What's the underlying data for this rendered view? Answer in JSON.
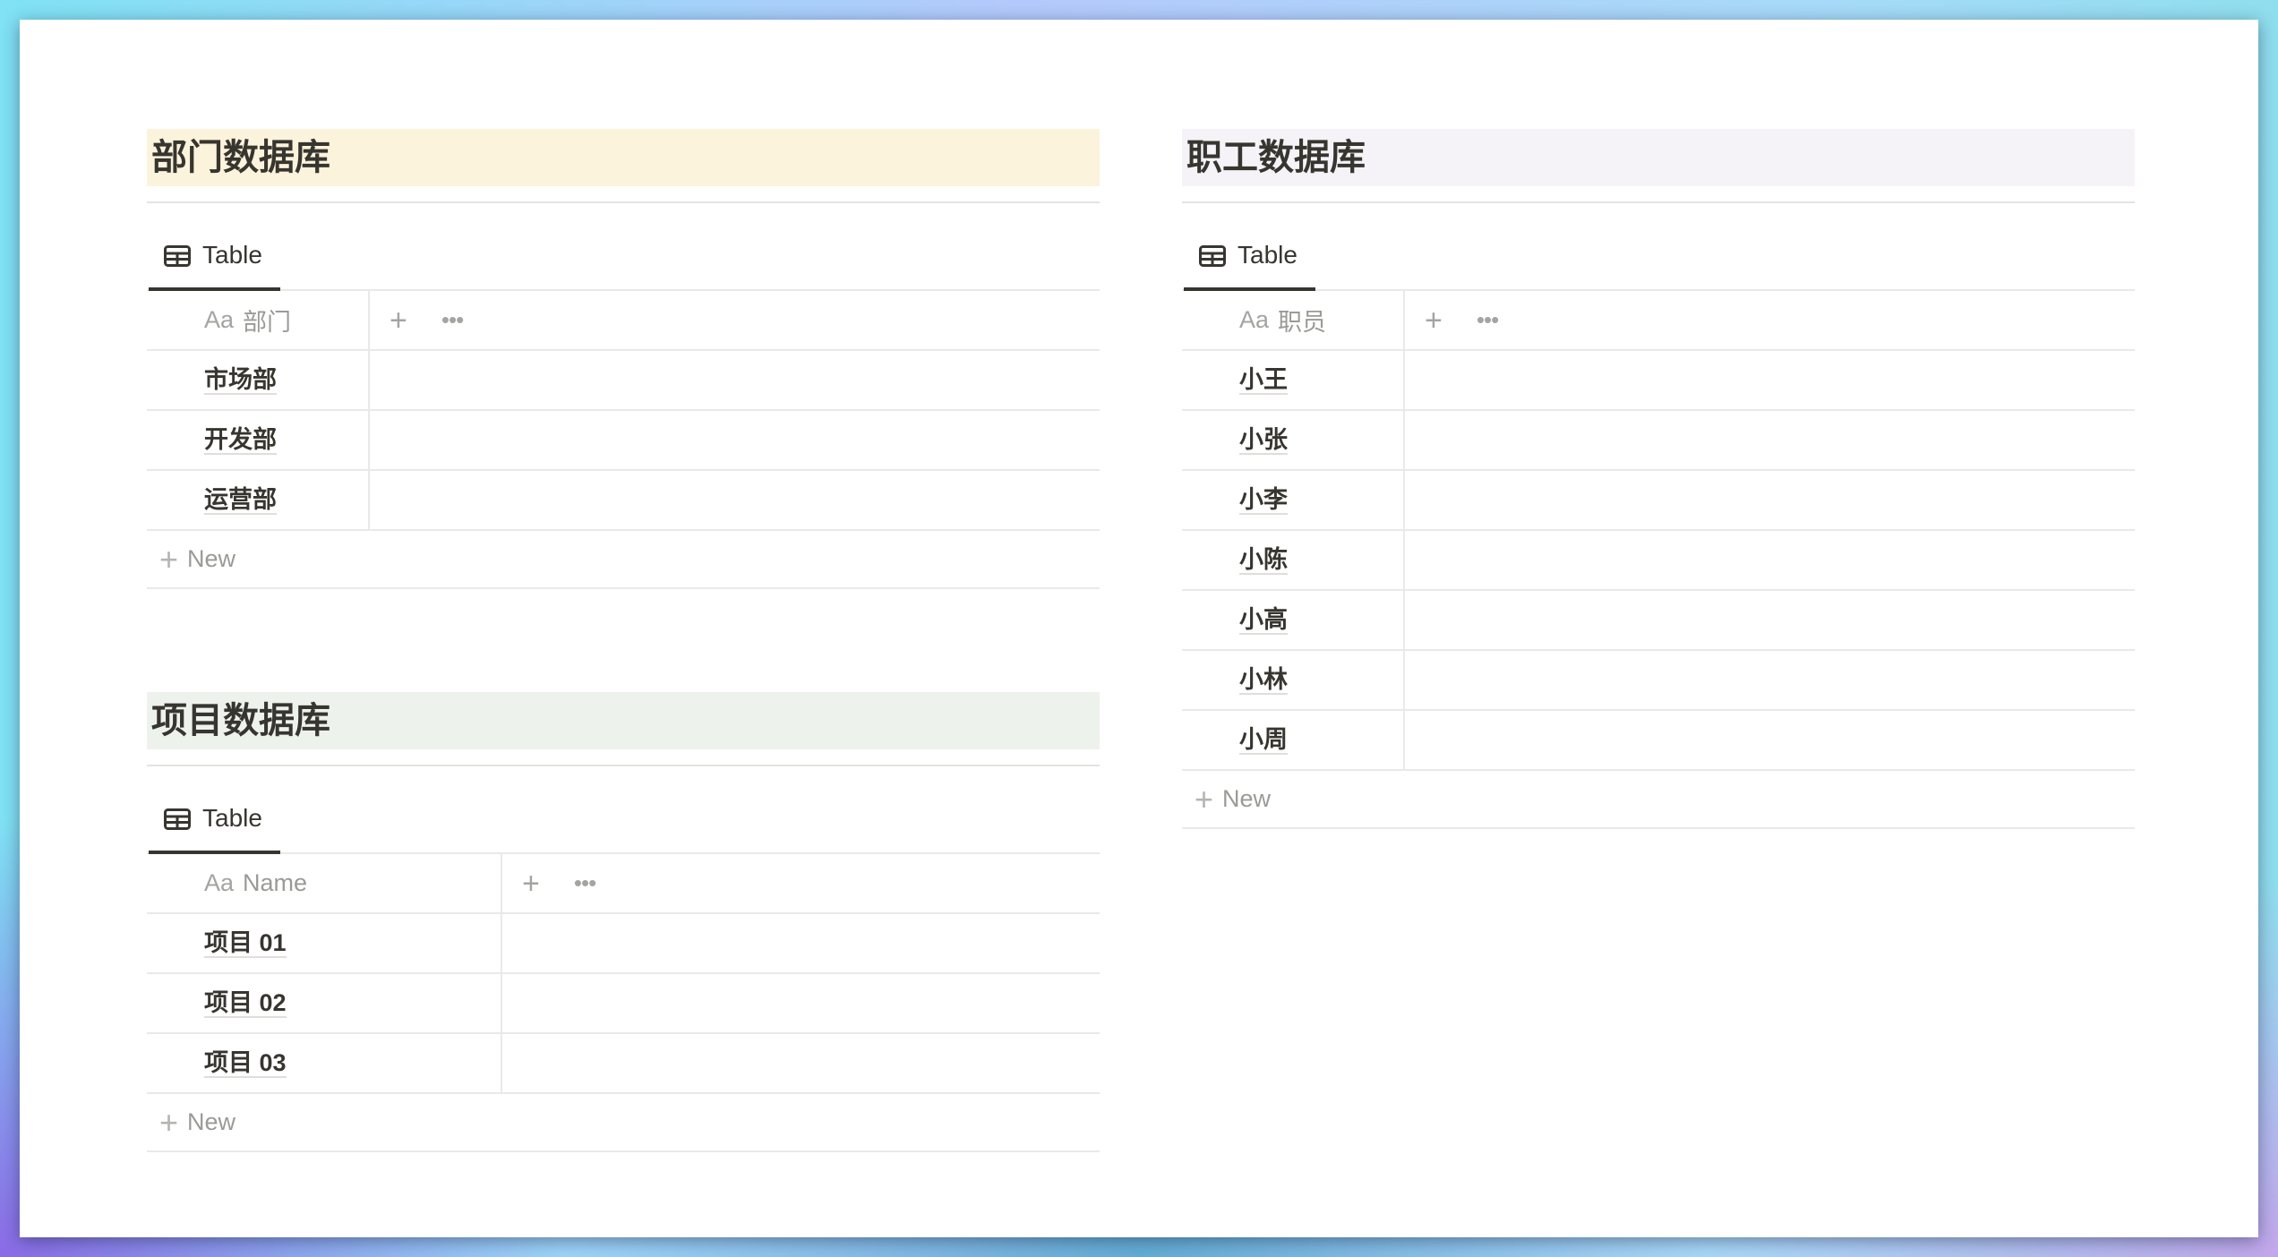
{
  "sections": {
    "departments": {
      "title": "部门数据库",
      "view_tab": "Table",
      "column_icon": "Aa",
      "column_header": "部门",
      "rows": [
        "市场部",
        "开发部",
        "运营部"
      ],
      "new_label": "New",
      "heading_color": "#fbf3db"
    },
    "employees": {
      "title": "职工数据库",
      "view_tab": "Table",
      "column_icon": "Aa",
      "column_header": "职员",
      "rows": [
        "小王",
        "小张",
        "小李",
        "小陈",
        "小高",
        "小林",
        "小周"
      ],
      "new_label": "New",
      "heading_color": "#f6f3f8"
    },
    "projects": {
      "title": "项目数据库",
      "view_tab": "Table",
      "column_icon": "Aa",
      "column_header": "Name",
      "rows": [
        "项目 01",
        "项目 02",
        "项目 03"
      ],
      "new_label": "New",
      "heading_color": "#edf3ec"
    }
  },
  "icons": {
    "view_tab": "table-icon",
    "add_property": "plus-icon",
    "more": "more-horizontal-icon",
    "add_row": "plus-icon"
  },
  "symbols": {
    "plus": "+",
    "dots": "•••"
  }
}
